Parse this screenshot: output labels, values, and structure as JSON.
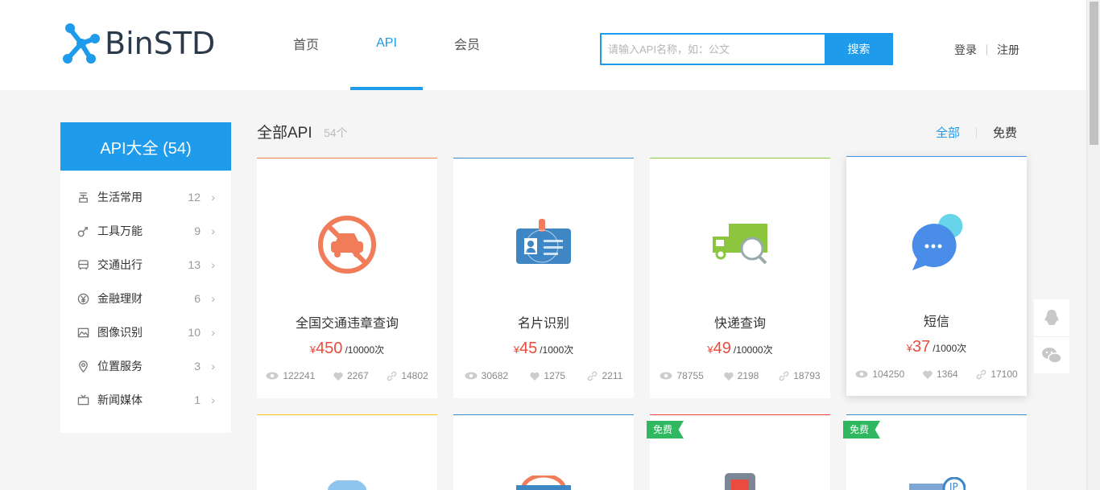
{
  "brand": {
    "name": "BinSTD",
    "accent": "#1e9bea"
  },
  "nav": {
    "items": [
      "首页",
      "API",
      "会员"
    ],
    "active": "API"
  },
  "search": {
    "placeholder": "请输入API名称，如：公文",
    "button": "搜索"
  },
  "auth": {
    "login": "登录",
    "register": "注册"
  },
  "sidebar": {
    "title": "API大全 (54)",
    "items": [
      {
        "label": "生活常用",
        "count": "12",
        "icon": "plant-icon"
      },
      {
        "label": "工具万能",
        "count": "9",
        "icon": "tool-icon"
      },
      {
        "label": "交通出行",
        "count": "13",
        "icon": "bus-icon"
      },
      {
        "label": "金融理财",
        "count": "6",
        "icon": "yen-coin-icon"
      },
      {
        "label": "图像识别",
        "count": "10",
        "icon": "image-icon"
      },
      {
        "label": "位置服务",
        "count": "3",
        "icon": "location-pin-icon"
      },
      {
        "label": "新闻媒体",
        "count": "1",
        "icon": "tv-icon"
      }
    ]
  },
  "main": {
    "title": "全部API",
    "count": "54个",
    "filters": {
      "all": "全部",
      "free": "免费"
    }
  },
  "cards": [
    {
      "name": "全国交通违章查询",
      "currency": "¥",
      "price": "450",
      "unit": "/10000次",
      "views": "122241",
      "likes": "2267",
      "links": "14802",
      "color": "#f07c5a",
      "icon": "no-car-icon"
    },
    {
      "name": "名片识别",
      "currency": "¥",
      "price": "45",
      "unit": "/1000次",
      "views": "30682",
      "likes": "1275",
      "links": "2211",
      "color": "#3a8bd0",
      "icon": "id-card-icon"
    },
    {
      "name": "快递查询",
      "currency": "¥",
      "price": "49",
      "unit": "/10000次",
      "views": "78755",
      "likes": "2198",
      "links": "18793",
      "color": "#8cc63f",
      "icon": "truck-search-icon"
    },
    {
      "name": "短信",
      "currency": "¥",
      "price": "37",
      "unit": "/1000次",
      "views": "104250",
      "likes": "1364",
      "links": "17100",
      "color": "#4a90e2",
      "icon": "chat-bubble-icon"
    }
  ],
  "row2": {
    "badge": "免费"
  }
}
